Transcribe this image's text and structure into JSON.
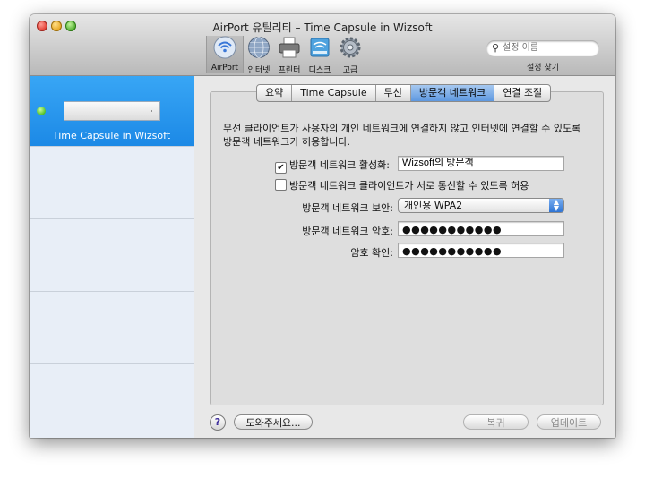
{
  "window": {
    "title": "AirPort 유틸리티 – Time Capsule in Wizsoft"
  },
  "toolbar": {
    "items": [
      {
        "label": "AirPort",
        "icon": "airport-icon"
      },
      {
        "label": "인터넷",
        "icon": "internet-globe-icon"
      },
      {
        "label": "프린터",
        "icon": "printer-icon"
      },
      {
        "label": "디스크",
        "icon": "disk-icon"
      },
      {
        "label": "고급",
        "icon": "gear-icon"
      }
    ],
    "active": "AirPort"
  },
  "search": {
    "placeholder": "설정 이름",
    "label": "설정 찾기"
  },
  "sidebar": {
    "device_name": "Time Capsule in Wizsoft",
    "status_color": "#4fbe25"
  },
  "tabs": [
    {
      "label": "요약"
    },
    {
      "label": "Time Capsule"
    },
    {
      "label": "무선"
    },
    {
      "label": "방문객 네트워크"
    },
    {
      "label": "연결 조절"
    }
  ],
  "selected_tab": "방문객 네트워크",
  "form": {
    "description": "무선 클라이언트가 사용자의 개인 네트워크에 연결하지 않고 인터넷에 연결할 수 있도록 방문객 네트워크가 허용합니다.",
    "enable_label": "방문객 네트워크 활성화:",
    "enable_checked": true,
    "network_name": "Wizsoft의 방문객",
    "allow_label": "방문객 네트워크 클라이언트가 서로 통신할 수 있도록 허용",
    "allow_checked": false,
    "security_label": "방문객 네트워크 보안:",
    "security_value": "개인용 WPA2",
    "password_label": "방문객 네트워크 암호:",
    "password_value": "●●●●●●●●●●●",
    "confirm_label": "암호 확인:",
    "confirm_value": "●●●●●●●●●●●"
  },
  "footer": {
    "help": "?",
    "assist_button": "도와주세요...",
    "revert_button": "복귀",
    "update_button": "업데이트"
  },
  "colors": {
    "selection_blue": "#1c89e6",
    "tab_selected": "#5e98e0"
  }
}
